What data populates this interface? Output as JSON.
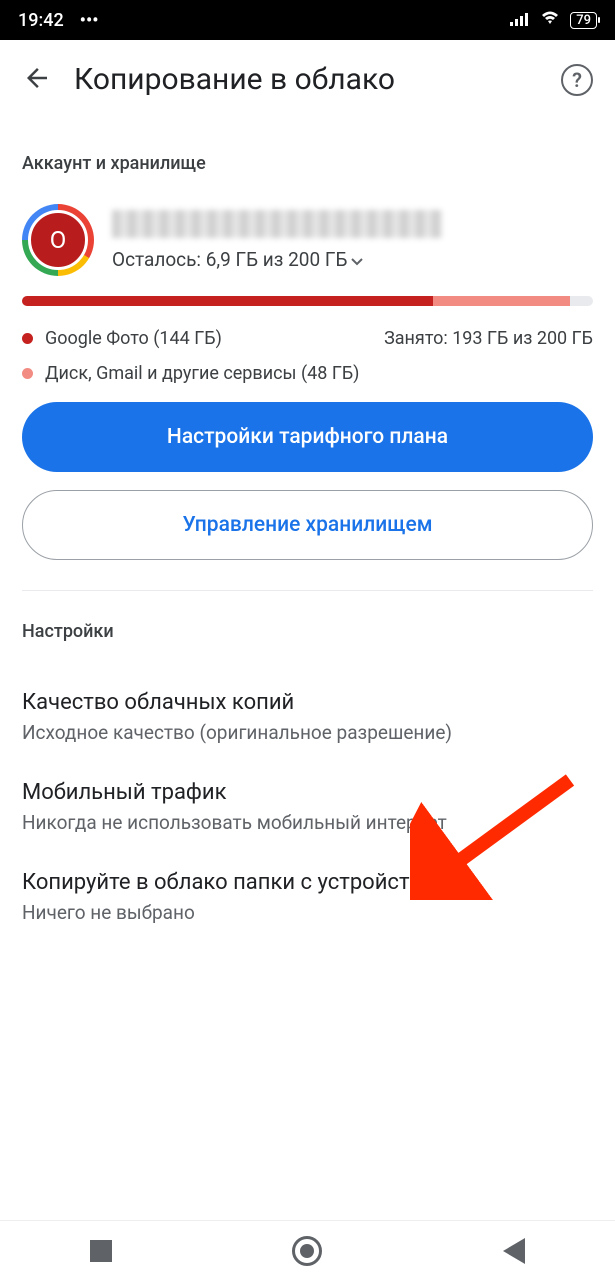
{
  "status": {
    "time": "19:42",
    "battery": "79"
  },
  "header": {
    "title": "Копирование в облако"
  },
  "account_section": {
    "label": "Аккаунт и хранилище",
    "avatar_letter": "O",
    "remaining": "Осталось: 6,9 ГБ из 200 ГБ",
    "legend_photos": "Google Фото (144 ГБ)",
    "used_total": "Занято: 193 ГБ из 200 ГБ",
    "legend_other": "Диск, Gmail и другие сервисы (48 ГБ)"
  },
  "buttons": {
    "plan": "Настройки тарифного плана",
    "manage": "Управление хранилищем"
  },
  "settings_section": {
    "label": "Настройки",
    "quality_title": "Качество облачных копий",
    "quality_sub": "Исходное качество (оригинальное разрешение)",
    "mobile_title": "Мобильный трафик",
    "mobile_sub": "Никогда не использовать мобильный интернет",
    "folders_title": "Копируйте в облако папки с устройства",
    "folders_sub": "Ничего не выбрано"
  }
}
